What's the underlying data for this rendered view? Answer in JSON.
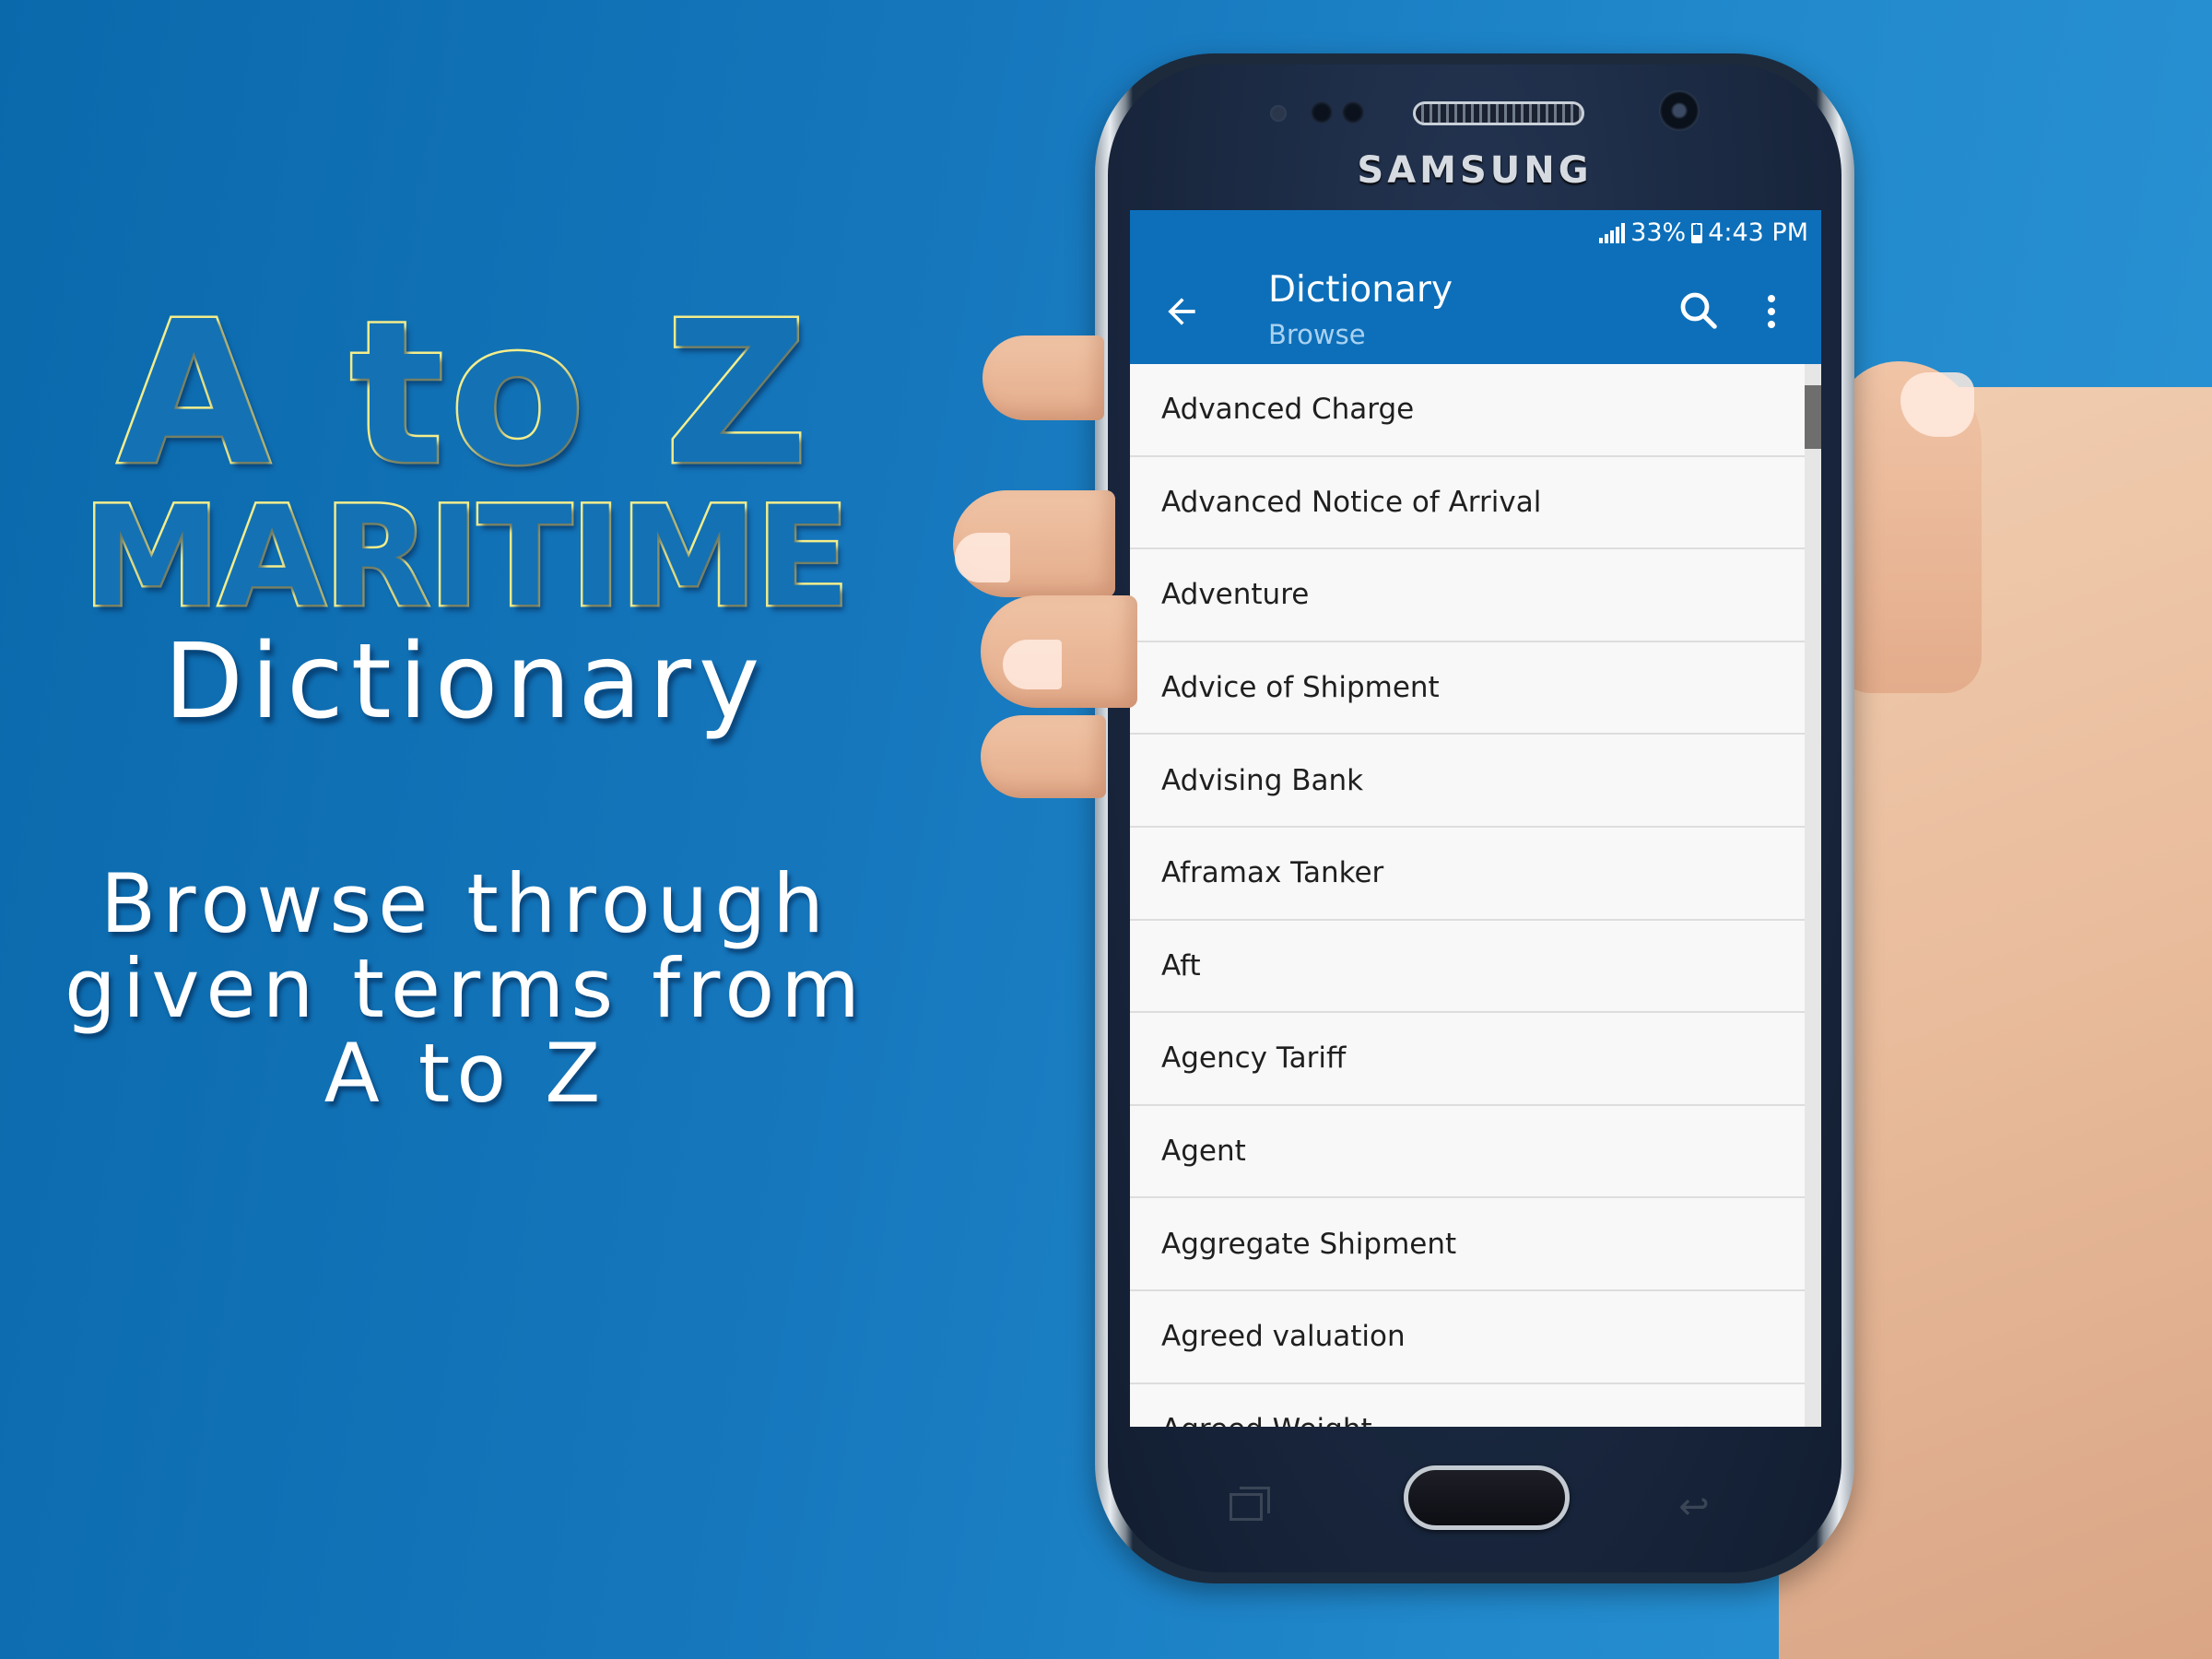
{
  "promo": {
    "hero_line1": "A to Z",
    "hero_line2": "MARITIME",
    "hero_line3": "Dictionary",
    "tagline_lines": [
      "Browse through",
      "given terms from",
      "A to Z"
    ],
    "hero_stroke_color": "#f4ee8c",
    "hero_fill_color": "#1471b3"
  },
  "device": {
    "brand": "SAMSUNG"
  },
  "status_bar": {
    "battery": "33%",
    "time": "4:43 PM",
    "signal_icon": "signal-icon",
    "battery_icon": "battery-charging-icon"
  },
  "app_bar": {
    "title": "Dictionary",
    "subtitle": "Browse",
    "back_icon": "arrow-back-icon",
    "search_icon": "search-icon",
    "more_icon": "more-vert-icon",
    "color": "#0d6fba"
  },
  "terms": [
    "Advanced Charge",
    "Advanced Notice of Arrival",
    "Adventure",
    "Advice of Shipment",
    "Advising Bank",
    "Aframax Tanker",
    "Aft",
    "Agency Tariff",
    "Agent",
    "Aggregate Shipment",
    "Agreed valuation",
    "Agreed Weight"
  ],
  "scroll": {
    "position_fraction": 0.02,
    "visible_fraction": 0.06
  },
  "nav_keys": {
    "recent_icon": "recent-apps-icon",
    "home": "home-button",
    "back_icon": "back-key-icon"
  }
}
